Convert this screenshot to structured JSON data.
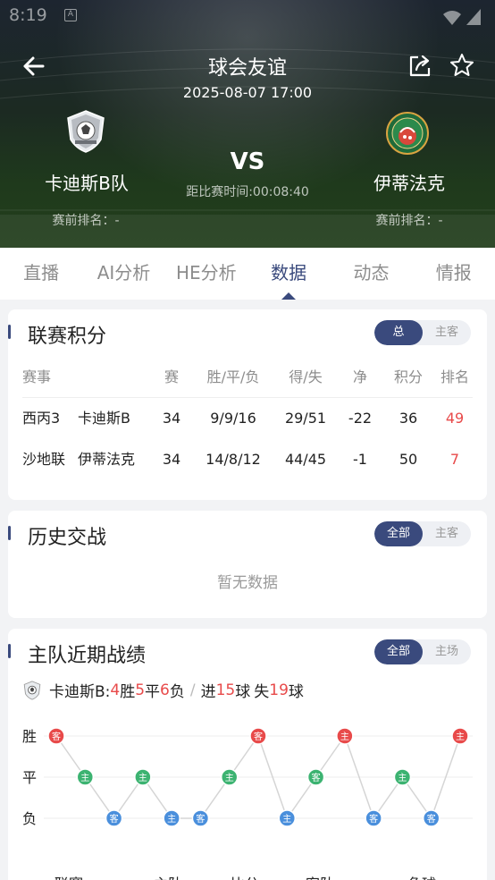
{
  "status_bar": {
    "time": "8:19",
    "indicator": "A"
  },
  "header": {
    "title": "球会友谊",
    "datetime": "2025-08-07 17:00",
    "vs": "VS",
    "countdown": "距比赛时间:00:08:40",
    "home": {
      "name": "卡迪斯B队",
      "rank": "赛前排名：-"
    },
    "away": {
      "name": "伊蒂法克",
      "rank": "赛前排名：-"
    },
    "icons": [
      "back-arrow-icon",
      "share-icon",
      "star-icon"
    ]
  },
  "tabs": [
    {
      "label": "直播",
      "active": false
    },
    {
      "label": "AI分析",
      "active": false
    },
    {
      "label": "HE分析",
      "active": false
    },
    {
      "label": "数据",
      "active": true
    },
    {
      "label": "动态",
      "active": false
    },
    {
      "label": "情报",
      "active": false
    }
  ],
  "league_standings": {
    "title": "联赛积分",
    "toggle": {
      "on": "总",
      "off": "主客"
    },
    "headers": [
      "赛事",
      "赛",
      "胜/平/负",
      "得/失",
      "净",
      "积分",
      "排名"
    ],
    "rows": [
      {
        "league": "西丙3",
        "team": "卡迪斯B",
        "played": "34",
        "wdl": "9/9/16",
        "gf_ga": "29/51",
        "net": "-22",
        "points": "36",
        "rank": "49"
      },
      {
        "league": "沙地联",
        "team": "伊蒂法克",
        "played": "34",
        "wdl": "14/8/12",
        "gf_ga": "44/45",
        "net": "-1",
        "points": "50",
        "rank": "7"
      }
    ]
  },
  "head_to_head": {
    "title": "历史交战",
    "toggle": {
      "on": "全部",
      "off": "主客"
    },
    "empty_text": "暂无数据"
  },
  "home_recent": {
    "title": "主队近期战绩",
    "toggle": {
      "on": "全部",
      "off": "主场"
    },
    "summary": {
      "team": "卡迪斯B:",
      "wins": "4",
      "win_label": "胜",
      "draws": "5",
      "draw_label": "平",
      "losses": "6",
      "loss_label": "负",
      "divider": "/",
      "scored_label": "进",
      "scored": "15",
      "ball_label": "球",
      "conceded_label": "失",
      "conceded": "19",
      "ball_label2": "球"
    },
    "x_labels": [
      "联赛",
      "主队",
      "比分",
      "客队",
      "角球"
    ]
  },
  "colors": {
    "accent": "#3a4a7d",
    "win": "#e84a4a",
    "draw": "#3cb371",
    "loss": "#4a8fdc"
  },
  "chart_data": {
    "type": "line",
    "y_categories": [
      "胜",
      "平",
      "负"
    ],
    "points": [
      {
        "result": "胜",
        "venue": "客"
      },
      {
        "result": "平",
        "venue": "主"
      },
      {
        "result": "负",
        "venue": "客"
      },
      {
        "result": "平",
        "venue": "主"
      },
      {
        "result": "负",
        "venue": "主"
      },
      {
        "result": "负",
        "venue": "客"
      },
      {
        "result": "平",
        "venue": "主"
      },
      {
        "result": "胜",
        "venue": "客"
      },
      {
        "result": "负",
        "venue": "主"
      },
      {
        "result": "平",
        "venue": "客"
      },
      {
        "result": "胜",
        "venue": "主"
      },
      {
        "result": "负",
        "venue": "客"
      },
      {
        "result": "平",
        "venue": "主"
      },
      {
        "result": "负",
        "venue": "客"
      },
      {
        "result": "胜",
        "venue": "主"
      }
    ]
  }
}
